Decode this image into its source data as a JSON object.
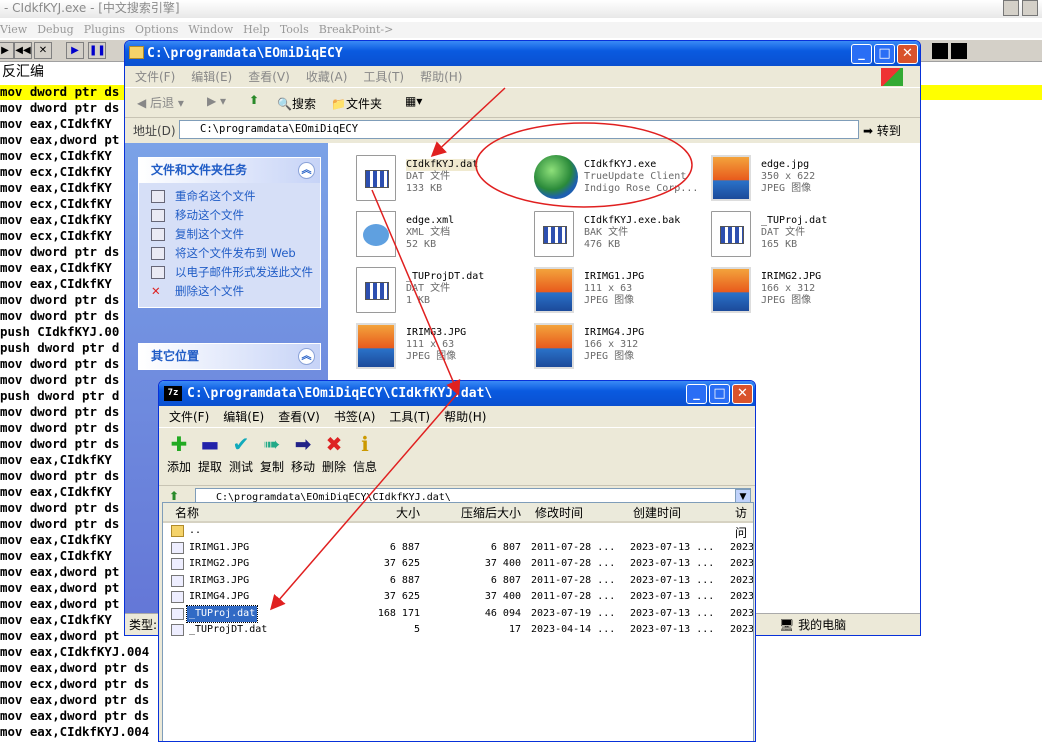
{
  "debugger": {
    "title": "- CIdkfKYJ.exe - [中文搜索引擎]",
    "menu": [
      "View",
      "Debug",
      "Plugins",
      "Options",
      "Window",
      "Help",
      "Tools",
      "BreakPoint->"
    ],
    "pane_label": "反汇编",
    "asm_lines": [
      "mov dword ptr ds",
      "mov dword ptr ds",
      "mov eax,CIdkfKY",
      "mov eax,dword pt",
      "mov ecx,CIdkfKY",
      "mov ecx,CIdkfKY",
      "mov eax,CIdkfKY",
      "mov ecx,CIdkfKY",
      "mov eax,CIdkfKY",
      "mov ecx,CIdkfKY",
      "mov dword ptr ds",
      "mov eax,CIdkfKY",
      "mov eax,CIdkfKY",
      "mov dword ptr ds",
      "mov dword ptr ds",
      "push CIdkfKYJ.00",
      "push dword ptr d",
      "mov dword ptr ds",
      "mov dword ptr ds",
      "push dword ptr d",
      "mov dword ptr ds",
      "mov dword ptr ds",
      "mov dword ptr ds",
      "mov eax,CIdkfKY",
      "mov dword ptr ds",
      "mov eax,CIdkfKY",
      "mov dword ptr ds",
      "mov dword ptr ds",
      "mov eax,CIdkfKY",
      "mov eax,CIdkfKY",
      "mov eax,dword pt",
      "mov eax,dword pt",
      "mov eax,dword pt",
      "mov eax,CIdkfKY",
      "mov eax,dword pt",
      "mov eax,CIdkfKYJ.004",
      "mov eax,dword ptr ds",
      "mov ecx,dword ptr ds",
      "mov eax,dword ptr ds",
      "mov eax,dword ptr ds",
      "mov eax,CIdkfKYJ.004"
    ]
  },
  "explorer": {
    "title": "C:\\programdata\\EOmiDiqECY",
    "menu": [
      "文件(F)",
      "编辑(E)",
      "查看(V)",
      "收藏(A)",
      "工具(T)",
      "帮助(H)"
    ],
    "toolbar": {
      "back": "后退",
      "search": "搜索",
      "folders": "文件夹"
    },
    "address_label": "地址(D)",
    "address": "C:\\programdata\\EOmiDiqECY",
    "go": "转到",
    "tasks": {
      "title": "文件和文件夹任务",
      "items": [
        "重命名这个文件",
        "移动这个文件",
        "复制这个文件",
        "将这个文件发布到 Web",
        "以电子邮件形式发送此文件",
        "删除这个文件"
      ]
    },
    "other_places_title": "其它位置",
    "files": [
      {
        "name": "CIdkfKYJ.dat",
        "line1": "DAT 文件",
        "line2": "133 KB",
        "icon": "dat-file-icon"
      },
      {
        "name": "CIdkfKYJ.exe",
        "line1": "TrueUpdate Client",
        "line2": "Indigo Rose Corp...",
        "icon": "globe-exe-icon"
      },
      {
        "name": "edge.jpg",
        "line1": "350 x 622",
        "line2": "JPEG 图像",
        "icon": "jpeg-image-icon"
      },
      {
        "name": "edge.xml",
        "line1": "XML 文档",
        "line2": "52 KB",
        "icon": "xml-document-icon"
      },
      {
        "name": "CIdkfKYJ.exe.bak",
        "line1": "BAK 文件",
        "line2": "476 KB",
        "icon": "bak-file-icon"
      },
      {
        "name": "_TUProj.dat",
        "line1": "DAT 文件",
        "line2": "165 KB",
        "icon": "dat-file-icon"
      },
      {
        "name": "_TUProjDT.dat",
        "line1": "DAT 文件",
        "line2": "1 KB",
        "icon": "dat-file-icon"
      },
      {
        "name": "IRIMG1.JPG",
        "line1": "111 x 63",
        "line2": "JPEG 图像",
        "icon": "jpeg-image-icon"
      },
      {
        "name": "IRIMG2.JPG",
        "line1": "166 x 312",
        "line2": "JPEG 图像",
        "icon": "jpeg-image-icon"
      },
      {
        "name": "IRIMG3.JPG",
        "line1": "111 x 63",
        "line2": "JPEG 图像",
        "icon": "jpeg-image-icon"
      },
      {
        "name": "IRIMG4.JPG",
        "line1": "166 x 312",
        "line2": "JPEG 图像",
        "icon": "jpeg-image-icon"
      }
    ],
    "status_type": "类型:",
    "status_location": "我的电脑"
  },
  "zip": {
    "title": "C:\\programdata\\EOmiDiqECY\\CIdkfKYJ.dat\\",
    "app_badge": "7z",
    "menu": [
      "文件(F)",
      "编辑(E)",
      "查看(V)",
      "书签(A)",
      "工具(T)",
      "帮助(H)"
    ],
    "tools": [
      "添加",
      "提取",
      "测试",
      "复制",
      "移动",
      "删除",
      "信息"
    ],
    "address": "C:\\programdata\\EOmiDiqECY\\CIdkfKYJ.dat\\",
    "columns": [
      "名称",
      "大小",
      "压缩后大小",
      "修改时间",
      "创建时间",
      "访问"
    ],
    "rows": [
      {
        "name": "..",
        "size": "",
        "packed": "",
        "modified": "",
        "created": "",
        "accessed": "",
        "folder": true
      },
      {
        "name": "IRIMG1.JPG",
        "size": "6 887",
        "packed": "6 807",
        "modified": "2011-07-28 ...",
        "created": "2023-07-13 ...",
        "accessed": "2023"
      },
      {
        "name": "IRIMG2.JPG",
        "size": "37 625",
        "packed": "37 400",
        "modified": "2011-07-28 ...",
        "created": "2023-07-13 ...",
        "accessed": "2023"
      },
      {
        "name": "IRIMG3.JPG",
        "size": "6 887",
        "packed": "6 807",
        "modified": "2011-07-28 ...",
        "created": "2023-07-13 ...",
        "accessed": "2023"
      },
      {
        "name": "IRIMG4.JPG",
        "size": "37 625",
        "packed": "37 400",
        "modified": "2011-07-28 ...",
        "created": "2023-07-13 ...",
        "accessed": "2023"
      },
      {
        "name": "_TUProj.dat",
        "size": "168 171",
        "packed": "46 094",
        "modified": "2023-07-19 ...",
        "created": "2023-07-13 ...",
        "accessed": "2023",
        "selected": true
      },
      {
        "name": "_TUProjDT.dat",
        "size": "5",
        "packed": "17",
        "modified": "2023-04-14 ...",
        "created": "2023-07-13 ...",
        "accessed": "2023"
      }
    ]
  },
  "colors": {
    "annotation": "#e02020",
    "highlight": "#ffff00",
    "xp_blue": "#0a5ae0"
  }
}
